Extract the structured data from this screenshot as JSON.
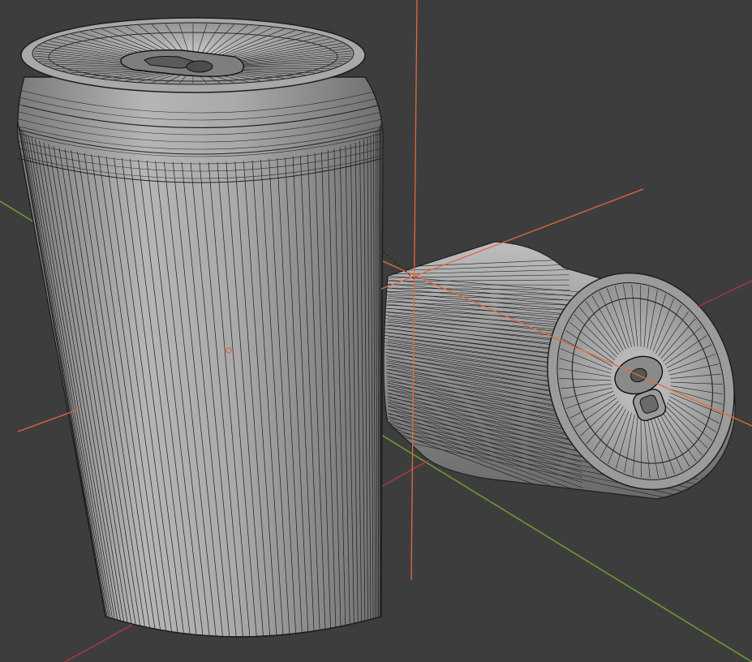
{
  "viewport": {
    "background_color": "#3d3d3d",
    "grid": "on",
    "wireframe_overlay": "on"
  },
  "colors": {
    "x_axis": "#a4384a",
    "y_axis": "#6c9a2e",
    "empty_axis": "#e06a3a",
    "mesh_light": "#b2b2b2",
    "mesh_mid": "#8f8f8f",
    "mesh_dark": "#5c5c5c",
    "wire": "#1e1e1e"
  },
  "objects": [
    {
      "name": "upright-can",
      "kind": "can",
      "state": "upright",
      "selected": false
    },
    {
      "name": "crushed-can",
      "kind": "can",
      "state": "crushed, lying on side",
      "selected": false
    }
  ],
  "empties": [
    {
      "name": "upright-can-origin",
      "kind": "origin-point"
    },
    {
      "name": "crushed-can-empty",
      "kind": "plain-axes"
    }
  ]
}
